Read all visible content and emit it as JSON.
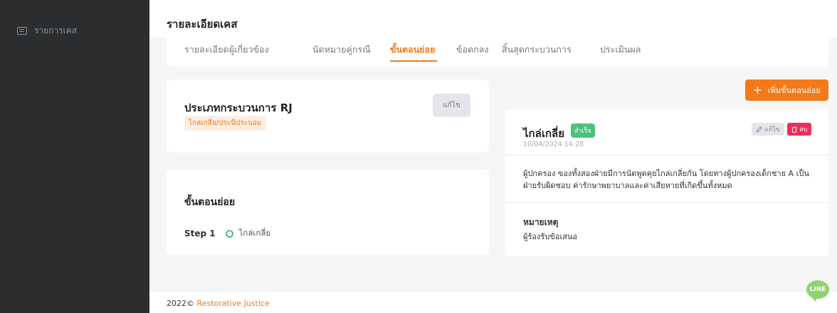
{
  "sidebar": {
    "items": [
      {
        "label": "รายการเคส",
        "icon": "list-icon"
      }
    ]
  },
  "header": {
    "title": "รายละเอียดเคส"
  },
  "tabs": [
    {
      "label": "รายละเอียด"
    },
    {
      "label": "ผู้เกี่ยวข้อง"
    },
    {
      "label": "นัดหมายคู่กรณี"
    },
    {
      "label": "ขั้นตอนย่อย",
      "active": true
    },
    {
      "label": "ข้อตกลง"
    },
    {
      "label": "สิ้นสุดกระบวนการ"
    },
    {
      "label": "ประเมินผล"
    }
  ],
  "rj_card": {
    "title": "ประเภทกระบวนการ RJ",
    "badge": "ไกล่เกลี่ย/ประนีประนอม",
    "edit_label": "แก้ไข"
  },
  "steps_card": {
    "title": "ขั้นตอนย่อย",
    "steps": [
      {
        "label": "Step 1",
        "name": "ไกล่เกลี่ย"
      }
    ]
  },
  "add_button": {
    "label": "เพิ่มขั้นตอนย่อย"
  },
  "detail_card": {
    "title": "ไกล่เกลี่ย",
    "status": "สำเร็จ",
    "date": "10/04/2024 14:28",
    "edit_label": "แก้ไข",
    "delete_label": "ลบ",
    "description": "ผู้ปกครอง ของทั้งสองฝ่ายมีการนัดพูดคุยไกล่เกลี่ยกัน โดยทางผู้ปกครองเด็กชาย A เป็นฝ่ายรับผิดชอบ ค่ารักษาพยาบาลและค่าเสียหายที่เกิดขึ้นทั้งหมด",
    "note_label": "หมายเหตุ",
    "note_text": "ผู้ร้องรับข้อเสนอ"
  },
  "footer": {
    "prefix": "2022©",
    "link": "Restorative Justice"
  },
  "line_chat": {
    "label": "LINE"
  },
  "colors": {
    "accent": "#f27a1a",
    "success": "#4cc17a",
    "danger": "#ee2e5a",
    "sidebar": "#2b2d2e"
  }
}
